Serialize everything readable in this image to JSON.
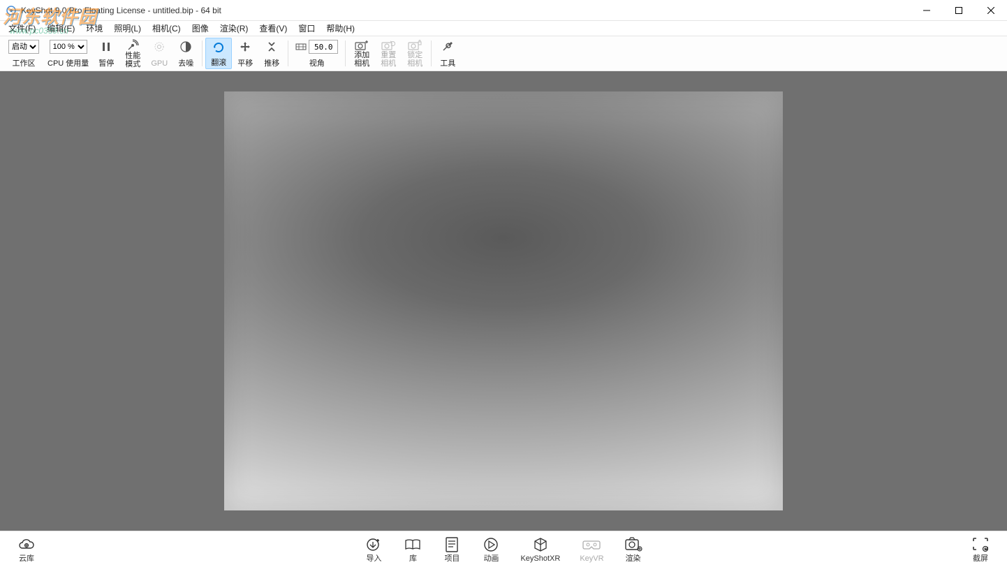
{
  "window": {
    "title": "KeyShot 9.0 Pro Floating License  - untitled.bip  - 64 bit"
  },
  "menu": {
    "items": [
      "文件(F)",
      "编辑(E)",
      "环境",
      "照明(L)",
      "相机(C)",
      "图像",
      "渲染(R)",
      "查看(V)",
      "窗口",
      "帮助(H)"
    ]
  },
  "toolbar": {
    "workspace_select": "启动",
    "workspace_label": "工作区",
    "cpu_select": "100 %",
    "cpu_label": "CPU 使用量",
    "pause_label": "暂停",
    "perf_label": "性能\n模式",
    "gpu_label": "GPU",
    "denoise_label": "去噪",
    "tumble_label": "翻滚",
    "pan_label": "平移",
    "dolly_label": "推移",
    "fov_value": "50.0",
    "fov_label": "视角",
    "addcam_label": "添加\n相机",
    "resetcam_label": "重置\n相机",
    "lockcam_label": "锁定\n相机",
    "tools_label": "工具"
  },
  "bottom": {
    "cloud": "云库",
    "import": "导入",
    "library": "库",
    "project": "项目",
    "animation": "动画",
    "keyshotxr": "KeyShotXR",
    "keyvr": "KeyVR",
    "render": "渲染",
    "screenshot": "截屏"
  },
  "watermark": {
    "line1": "河东软件园",
    "line2": "www.pc0359.cn"
  }
}
